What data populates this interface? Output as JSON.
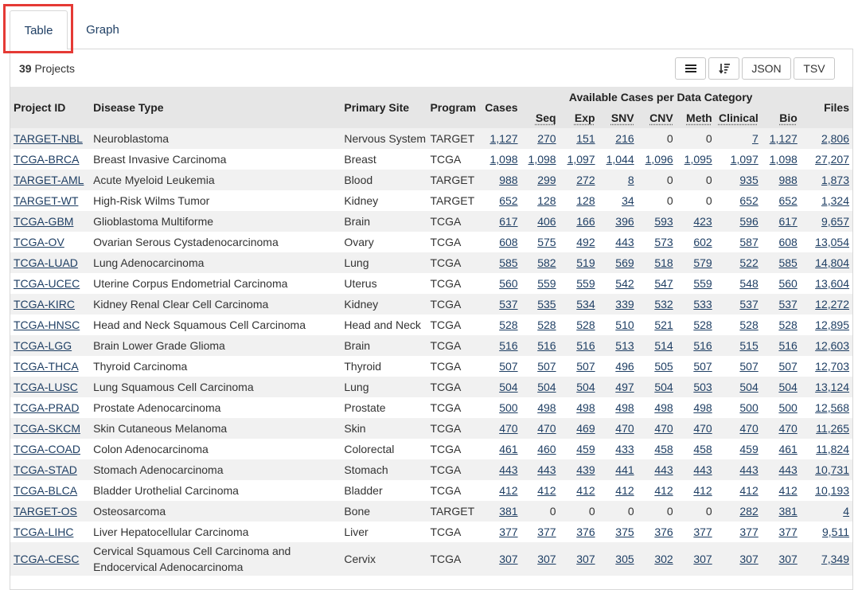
{
  "tabs": [
    {
      "label": "Table",
      "active": true
    },
    {
      "label": "Graph",
      "active": false
    }
  ],
  "summary": {
    "count": "39",
    "label": "Projects"
  },
  "toolbar": {
    "json_label": "JSON",
    "tsv_label": "TSV",
    "menu_icon": "list-icon",
    "sort_icon": "sort-descending-icon"
  },
  "colors": {
    "link": "#1f3f64",
    "header_bg": "#e6e6e6",
    "stripe": "#f1f1f1",
    "highlight": "#e53a35"
  },
  "columns": {
    "project_id": "Project ID",
    "disease_type": "Disease Type",
    "primary_site": "Primary Site",
    "program": "Program",
    "cases": "Cases",
    "group": "Available Cases per Data Category",
    "seq": "Seq",
    "exp": "Exp",
    "snv": "SNV",
    "cnv": "CNV",
    "meth": "Meth",
    "clinical": "Clinical",
    "bio": "Bio",
    "files": "Files"
  },
  "rows": [
    {
      "id": "TARGET-NBL",
      "disease": "Neuroblastoma",
      "site": "Nervous System",
      "program": "TARGET",
      "cases": "1,127",
      "seq": "270",
      "exp": "151",
      "snv": "216",
      "cnv": "0",
      "meth": "0",
      "clinical": "7",
      "bio": "1,127",
      "files": "2,806"
    },
    {
      "id": "TCGA-BRCA",
      "disease": "Breast Invasive Carcinoma",
      "site": "Breast",
      "program": "TCGA",
      "cases": "1,098",
      "seq": "1,098",
      "exp": "1,097",
      "snv": "1,044",
      "cnv": "1,096",
      "meth": "1,095",
      "clinical": "1,097",
      "bio": "1,098",
      "files": "27,207"
    },
    {
      "id": "TARGET-AML",
      "disease": "Acute Myeloid Leukemia",
      "site": "Blood",
      "program": "TARGET",
      "cases": "988",
      "seq": "299",
      "exp": "272",
      "snv": "8",
      "cnv": "0",
      "meth": "0",
      "clinical": "935",
      "bio": "988",
      "files": "1,873"
    },
    {
      "id": "TARGET-WT",
      "disease": "High-Risk Wilms Tumor",
      "site": "Kidney",
      "program": "TARGET",
      "cases": "652",
      "seq": "128",
      "exp": "128",
      "snv": "34",
      "cnv": "0",
      "meth": "0",
      "clinical": "652",
      "bio": "652",
      "files": "1,324"
    },
    {
      "id": "TCGA-GBM",
      "disease": "Glioblastoma Multiforme",
      "site": "Brain",
      "program": "TCGA",
      "cases": "617",
      "seq": "406",
      "exp": "166",
      "snv": "396",
      "cnv": "593",
      "meth": "423",
      "clinical": "596",
      "bio": "617",
      "files": "9,657"
    },
    {
      "id": "TCGA-OV",
      "disease": "Ovarian Serous Cystadenocarcinoma",
      "site": "Ovary",
      "program": "TCGA",
      "cases": "608",
      "seq": "575",
      "exp": "492",
      "snv": "443",
      "cnv": "573",
      "meth": "602",
      "clinical": "587",
      "bio": "608",
      "files": "13,054"
    },
    {
      "id": "TCGA-LUAD",
      "disease": "Lung Adenocarcinoma",
      "site": "Lung",
      "program": "TCGA",
      "cases": "585",
      "seq": "582",
      "exp": "519",
      "snv": "569",
      "cnv": "518",
      "meth": "579",
      "clinical": "522",
      "bio": "585",
      "files": "14,804"
    },
    {
      "id": "TCGA-UCEC",
      "disease": "Uterine Corpus Endometrial Carcinoma",
      "site": "Uterus",
      "program": "TCGA",
      "cases": "560",
      "seq": "559",
      "exp": "559",
      "snv": "542",
      "cnv": "547",
      "meth": "559",
      "clinical": "548",
      "bio": "560",
      "files": "13,604"
    },
    {
      "id": "TCGA-KIRC",
      "disease": "Kidney Renal Clear Cell Carcinoma",
      "site": "Kidney",
      "program": "TCGA",
      "cases": "537",
      "seq": "535",
      "exp": "534",
      "snv": "339",
      "cnv": "532",
      "meth": "533",
      "clinical": "537",
      "bio": "537",
      "files": "12,272"
    },
    {
      "id": "TCGA-HNSC",
      "disease": "Head and Neck Squamous Cell Carcinoma",
      "site": "Head and Neck",
      "program": "TCGA",
      "cases": "528",
      "seq": "528",
      "exp": "528",
      "snv": "510",
      "cnv": "521",
      "meth": "528",
      "clinical": "528",
      "bio": "528",
      "files": "12,895"
    },
    {
      "id": "TCGA-LGG",
      "disease": "Brain Lower Grade Glioma",
      "site": "Brain",
      "program": "TCGA",
      "cases": "516",
      "seq": "516",
      "exp": "516",
      "snv": "513",
      "cnv": "514",
      "meth": "516",
      "clinical": "515",
      "bio": "516",
      "files": "12,603"
    },
    {
      "id": "TCGA-THCA",
      "disease": "Thyroid Carcinoma",
      "site": "Thyroid",
      "program": "TCGA",
      "cases": "507",
      "seq": "507",
      "exp": "507",
      "snv": "496",
      "cnv": "505",
      "meth": "507",
      "clinical": "507",
      "bio": "507",
      "files": "12,703"
    },
    {
      "id": "TCGA-LUSC",
      "disease": "Lung Squamous Cell Carcinoma",
      "site": "Lung",
      "program": "TCGA",
      "cases": "504",
      "seq": "504",
      "exp": "504",
      "snv": "497",
      "cnv": "504",
      "meth": "503",
      "clinical": "504",
      "bio": "504",
      "files": "13,124"
    },
    {
      "id": "TCGA-PRAD",
      "disease": "Prostate Adenocarcinoma",
      "site": "Prostate",
      "program": "TCGA",
      "cases": "500",
      "seq": "498",
      "exp": "498",
      "snv": "498",
      "cnv": "498",
      "meth": "498",
      "clinical": "500",
      "bio": "500",
      "files": "12,568"
    },
    {
      "id": "TCGA-SKCM",
      "disease": "Skin Cutaneous Melanoma",
      "site": "Skin",
      "program": "TCGA",
      "cases": "470",
      "seq": "470",
      "exp": "469",
      "snv": "470",
      "cnv": "470",
      "meth": "470",
      "clinical": "470",
      "bio": "470",
      "files": "11,265"
    },
    {
      "id": "TCGA-COAD",
      "disease": "Colon Adenocarcinoma",
      "site": "Colorectal",
      "program": "TCGA",
      "cases": "461",
      "seq": "460",
      "exp": "459",
      "snv": "433",
      "cnv": "458",
      "meth": "458",
      "clinical": "459",
      "bio": "461",
      "files": "11,824"
    },
    {
      "id": "TCGA-STAD",
      "disease": "Stomach Adenocarcinoma",
      "site": "Stomach",
      "program": "TCGA",
      "cases": "443",
      "seq": "443",
      "exp": "439",
      "snv": "441",
      "cnv": "443",
      "meth": "443",
      "clinical": "443",
      "bio": "443",
      "files": "10,731"
    },
    {
      "id": "TCGA-BLCA",
      "disease": "Bladder Urothelial Carcinoma",
      "site": "Bladder",
      "program": "TCGA",
      "cases": "412",
      "seq": "412",
      "exp": "412",
      "snv": "412",
      "cnv": "412",
      "meth": "412",
      "clinical": "412",
      "bio": "412",
      "files": "10,193"
    },
    {
      "id": "TARGET-OS",
      "disease": "Osteosarcoma",
      "site": "Bone",
      "program": "TARGET",
      "cases": "381",
      "seq": "0",
      "exp": "0",
      "snv": "0",
      "cnv": "0",
      "meth": "0",
      "clinical": "282",
      "bio": "381",
      "files": "4"
    },
    {
      "id": "TCGA-LIHC",
      "disease": "Liver Hepatocellular Carcinoma",
      "site": "Liver",
      "program": "TCGA",
      "cases": "377",
      "seq": "377",
      "exp": "376",
      "snv": "375",
      "cnv": "376",
      "meth": "377",
      "clinical": "377",
      "bio": "377",
      "files": "9,511"
    },
    {
      "id": "TCGA-CESC",
      "disease": "Cervical Squamous Cell Carcinoma and Endocervical Adenocarcinoma",
      "site": "Cervix",
      "program": "TCGA",
      "cases": "307",
      "seq": "307",
      "exp": "307",
      "snv": "305",
      "cnv": "302",
      "meth": "307",
      "clinical": "307",
      "bio": "307",
      "files": "7,349"
    }
  ]
}
